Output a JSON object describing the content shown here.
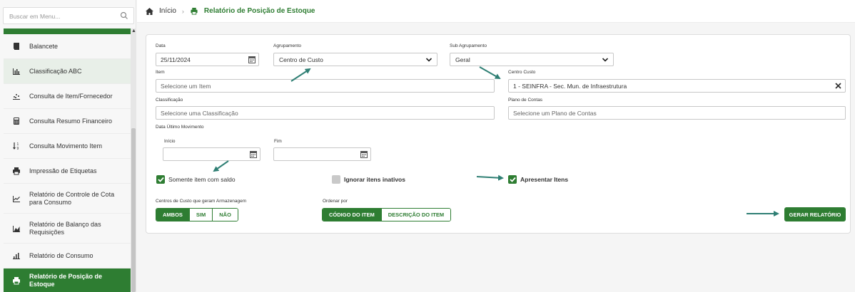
{
  "sidebar": {
    "search_placeholder": "Buscar em Menu...",
    "items": [
      {
        "label": "Balancete",
        "icon": "book-icon"
      },
      {
        "label": "Classificação ABC",
        "icon": "bar-chart-icon"
      },
      {
        "label": "Consulta de Item/Fornecedor",
        "icon": "scatter-chart-icon"
      },
      {
        "label": "Consulta Resumo Financeiro",
        "icon": "calculator-icon"
      },
      {
        "label": "Consulta Movimento Item",
        "icon": "sort-numeric-icon"
      },
      {
        "label": "Impressão de Etiquetas",
        "icon": "printer-icon"
      },
      {
        "label": "Relatório de Controle de Cota para Consumo",
        "icon": "line-chart-icon"
      },
      {
        "label": "Relatório de Balanço das Requisições",
        "icon": "area-chart-icon"
      },
      {
        "label": "Relatório de Consumo",
        "icon": "bar-chart-icon"
      },
      {
        "label": "Relatório de Posição de Estoque",
        "icon": "printer-icon"
      }
    ]
  },
  "breadcrumb": {
    "home": "Início",
    "current": "Relatório de Posição de Estoque"
  },
  "form": {
    "data_label": "Data",
    "data_value": "25/11/2024",
    "agrupamento_label": "Agrupamento",
    "agrupamento_value": "Centro de Custo",
    "sub_agrupamento_label": "Sub Agrupamento",
    "sub_agrupamento_value": "Geral",
    "item_label": "Item",
    "item_placeholder": "Selecione um Item",
    "centro_custo_label": "Centro Custo",
    "centro_custo_value": "1 - SEINFRA - Sec. Mun. de Infraestrutura",
    "classificacao_label": "Classificação",
    "classificacao_placeholder": "Selecione uma Classificação",
    "plano_label": "Plano de Contas",
    "plano_placeholder": "Selecione um Plano de Contas",
    "data_ultimo_label": "Data Último Movimento",
    "inicio_label": "Início",
    "fim_label": "Fim",
    "somente_label": "Somente item com saldo",
    "ignorar_label": "Ignorar itens inativos",
    "apresentar_label": "Apresentar Itens",
    "centros_label": "Centros de Custo que geram Armazenagem",
    "centros_options": [
      "AMBOS",
      "SIM",
      "NÃO"
    ],
    "ordenar_label": "Ordenar por",
    "ordenar_options": [
      "CÓDIGO DO ITEM",
      "DESCRIÇÃO DO ITEM"
    ],
    "generate_label": "GERAR RELATÓRIO"
  },
  "colors": {
    "primary": "#2e7d32",
    "arrow": "#2f7f74"
  }
}
